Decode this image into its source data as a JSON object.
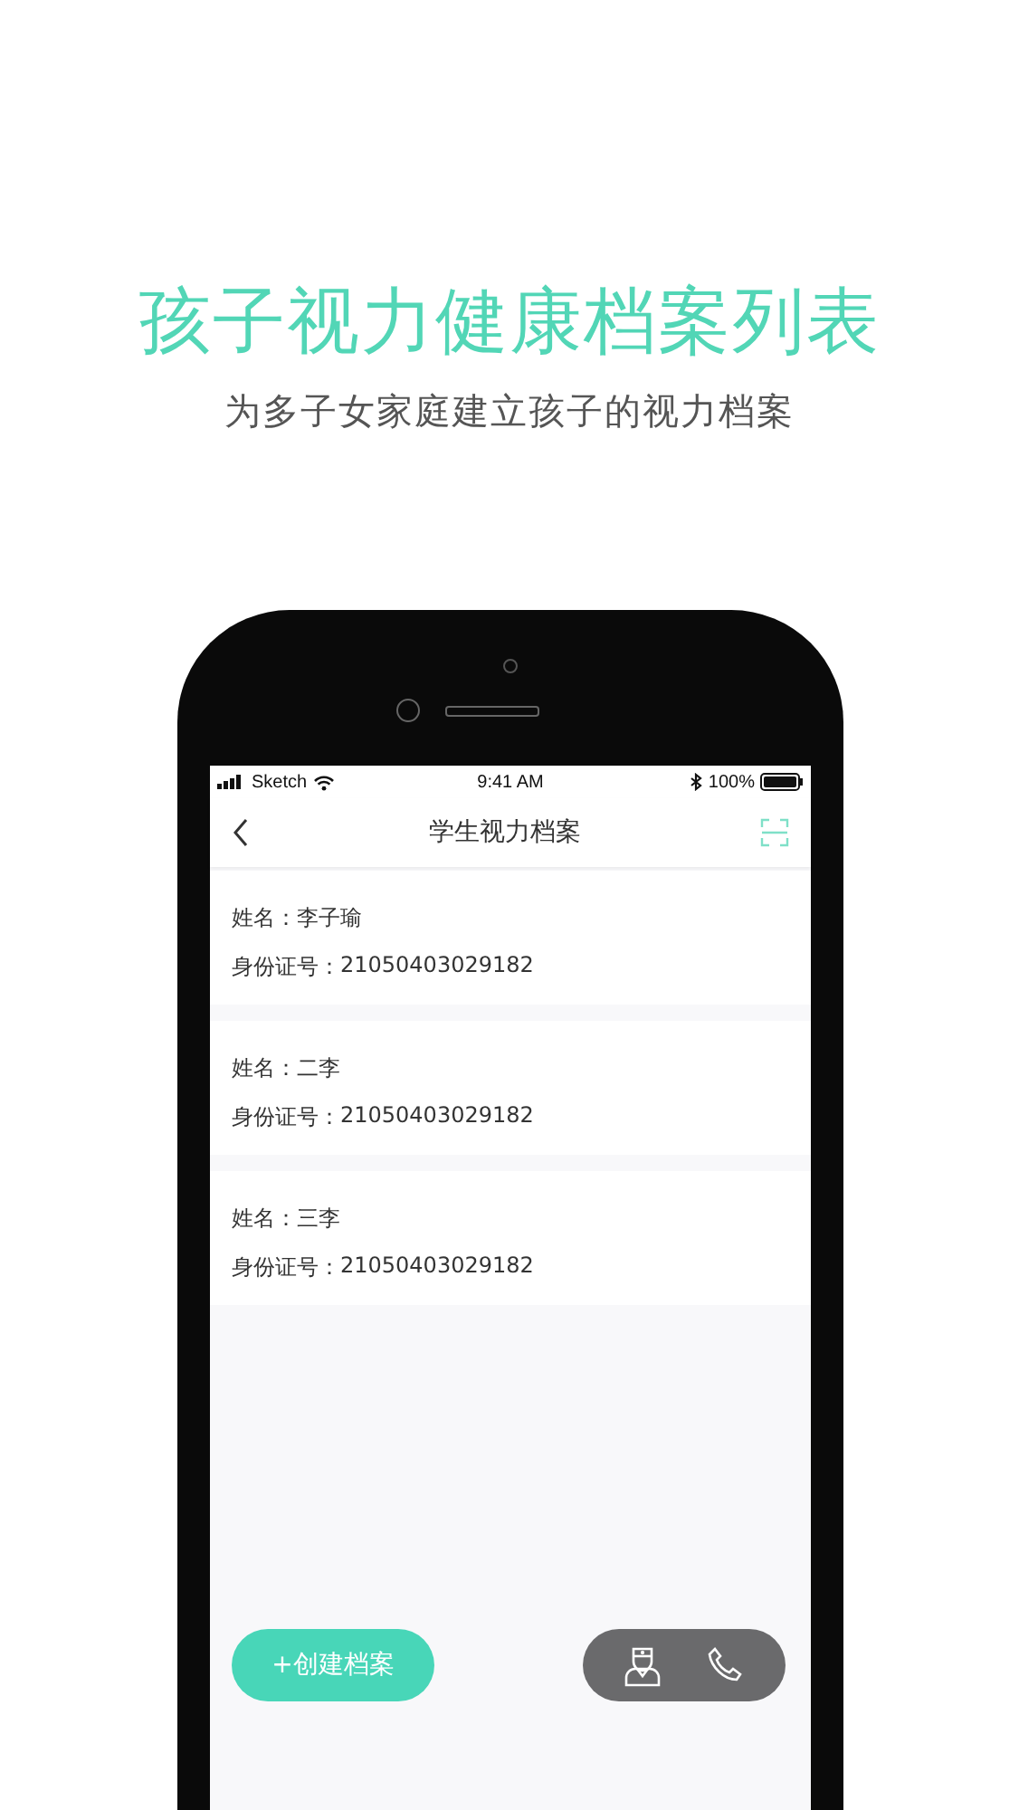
{
  "headline": "孩子视力健康档案列表",
  "subtitle": "为多子女家庭建立孩子的视力档案",
  "status_bar": {
    "carrier": "Sketch",
    "time": "9:41 AM",
    "battery": "100%"
  },
  "nav": {
    "title": "学生视力档案"
  },
  "records": [
    {
      "name_label": "姓名：",
      "name": "李子瑜",
      "id_label": "身份证号：",
      "id": "21050403029182"
    },
    {
      "name_label": "姓名：",
      "name": "二李",
      "id_label": "身份证号：",
      "id": "21050403029182"
    },
    {
      "name_label": "姓名：",
      "name": "三李",
      "id_label": "身份证号：",
      "id": "21050403029182"
    }
  ],
  "create_button": "+创建档案"
}
